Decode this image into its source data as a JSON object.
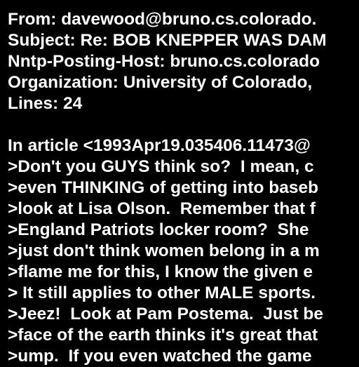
{
  "colors": {
    "background": "#000000",
    "text": "#ffffff"
  },
  "header": {
    "from": "From: davewood@bruno.cs.colorado.",
    "subject": "Subject: Re: BOB KNEPPER WAS DAM",
    "posting_host": "Nntp-Posting-Host: bruno.cs.colorado",
    "organization": "Organization: University of Colorado,",
    "lines": "Lines: 24"
  },
  "body": {
    "attribution": "In article <1993Apr19.035406.11473@",
    "quoted_lines": [
      ">Don't you GUYS think so?  I mean, c",
      ">even THINKING of getting into baseb",
      ">look at Lisa Olson.  Remember that f",
      ">England Patriots locker room?  She",
      ">just don't think women belong in a m",
      ">flame me for this, I know the given e",
      "> It still applies to other MALE sports.",
      ">Jeez!  Look at Pam Postema.  Just be",
      ">face of the earth thinks it's great that",
      ">ump.  If you even watched the game"
    ]
  }
}
